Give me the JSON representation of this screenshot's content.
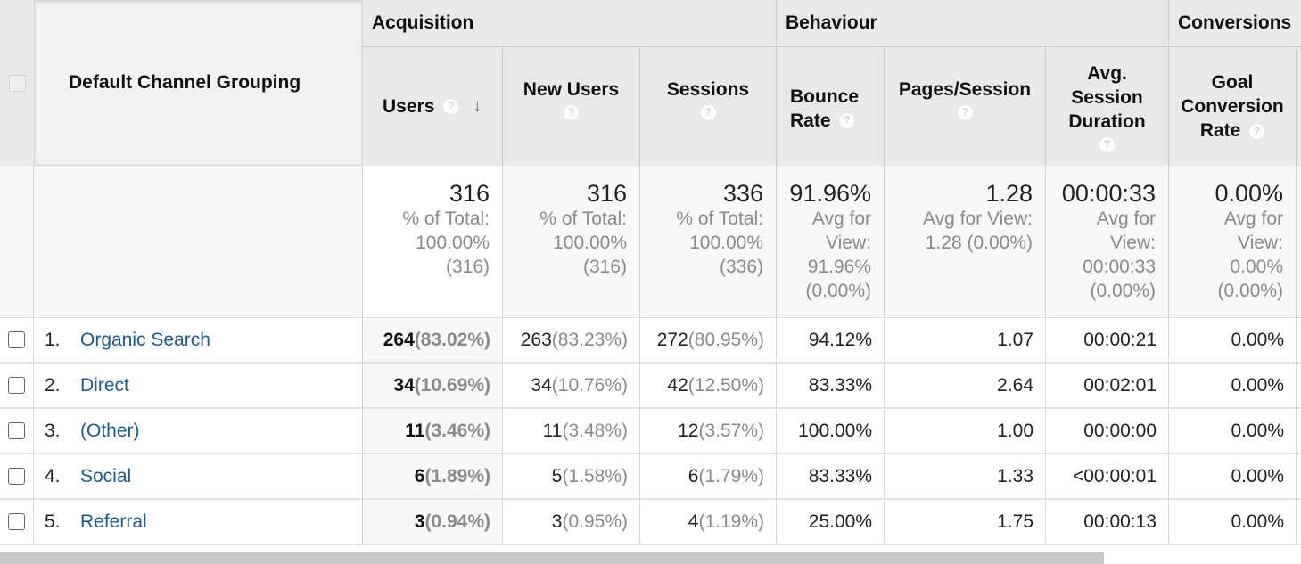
{
  "table": {
    "dimension_header": "Default Channel Grouping",
    "groups": [
      {
        "label": "Acquisition"
      },
      {
        "label": "Behaviour"
      },
      {
        "label": "Conversions"
      }
    ],
    "columns": [
      {
        "label": "Users",
        "help_icon": "question-circle-icon",
        "sorted": "descending",
        "sort_icon": "arrow-down-icon"
      },
      {
        "label": "New Users",
        "help_icon": "question-circle-icon"
      },
      {
        "label": "Sessions",
        "help_icon": "question-circle-icon"
      },
      {
        "label": "Bounce Rate",
        "help_icon": "question-circle-icon"
      },
      {
        "label": "Pages/Session",
        "help_icon": "question-circle-icon"
      },
      {
        "label": "Avg. Session Duration",
        "help_icon": "question-circle-icon"
      },
      {
        "label": "Goal Conversion Rate",
        "help_icon": "question-circle-icon"
      }
    ],
    "help_glyph": "?",
    "sort_glyph": "↓",
    "totals": [
      {
        "main": "316",
        "sub": [
          "% of Total:",
          "100.00%",
          "(316)"
        ]
      },
      {
        "main": "316",
        "sub": [
          "% of Total:",
          "100.00%",
          "(316)"
        ]
      },
      {
        "main": "336",
        "sub": [
          "% of Total:",
          "100.00%",
          "(336)"
        ]
      },
      {
        "main": "91.96%",
        "sub": [
          "Avg for",
          "View:",
          "91.96%",
          "(0.00%)"
        ]
      },
      {
        "main": "1.28",
        "sub": [
          "Avg for View:",
          "1.28 (0.00%)"
        ]
      },
      {
        "main": "00:00:33",
        "sub": [
          "Avg for",
          "View:",
          "00:00:33",
          "(0.00%)"
        ]
      },
      {
        "main": "0.00%",
        "sub": [
          "Avg for",
          "View:",
          "0.00%",
          "(0.00%)"
        ]
      }
    ],
    "rows": [
      {
        "index": "1.",
        "channel": "Organic Search",
        "users": "264",
        "users_pct": "(83.02%)",
        "new_users": "263",
        "new_users_pct": "(83.23%)",
        "sessions": "272",
        "sessions_pct": "(80.95%)",
        "bounce_rate": "94.12%",
        "pages_session": "1.07",
        "avg_duration": "00:00:21",
        "goal_conv": "0.00%"
      },
      {
        "index": "2.",
        "channel": "Direct",
        "users": "34",
        "users_pct": "(10.69%)",
        "new_users": "34",
        "new_users_pct": "(10.76%)",
        "sessions": "42",
        "sessions_pct": "(12.50%)",
        "bounce_rate": "83.33%",
        "pages_session": "2.64",
        "avg_duration": "00:02:01",
        "goal_conv": "0.00%"
      },
      {
        "index": "3.",
        "channel": "(Other)",
        "users": "11",
        "users_pct": "(3.46%)",
        "new_users": "11",
        "new_users_pct": "(3.48%)",
        "sessions": "12",
        "sessions_pct": "(3.57%)",
        "bounce_rate": "100.00%",
        "pages_session": "1.00",
        "avg_duration": "00:00:00",
        "goal_conv": "0.00%"
      },
      {
        "index": "4.",
        "channel": "Social",
        "users": "6",
        "users_pct": "(1.89%)",
        "new_users": "5",
        "new_users_pct": "(1.58%)",
        "sessions": "6",
        "sessions_pct": "(1.79%)",
        "bounce_rate": "83.33%",
        "pages_session": "1.33",
        "avg_duration": "<00:00:01",
        "goal_conv": "0.00%"
      },
      {
        "index": "5.",
        "channel": "Referral",
        "users": "3",
        "users_pct": "(0.94%)",
        "new_users": "3",
        "new_users_pct": "(0.95%)",
        "sessions": "4",
        "sessions_pct": "(1.19%)",
        "bounce_rate": "25.00%",
        "pages_session": "1.75",
        "avg_duration": "00:00:13",
        "goal_conv": "0.00%"
      }
    ]
  },
  "colors": {
    "link": "#1a5b96",
    "header_bg": "#e9e9e9",
    "muted_text": "#8a8a8a"
  }
}
